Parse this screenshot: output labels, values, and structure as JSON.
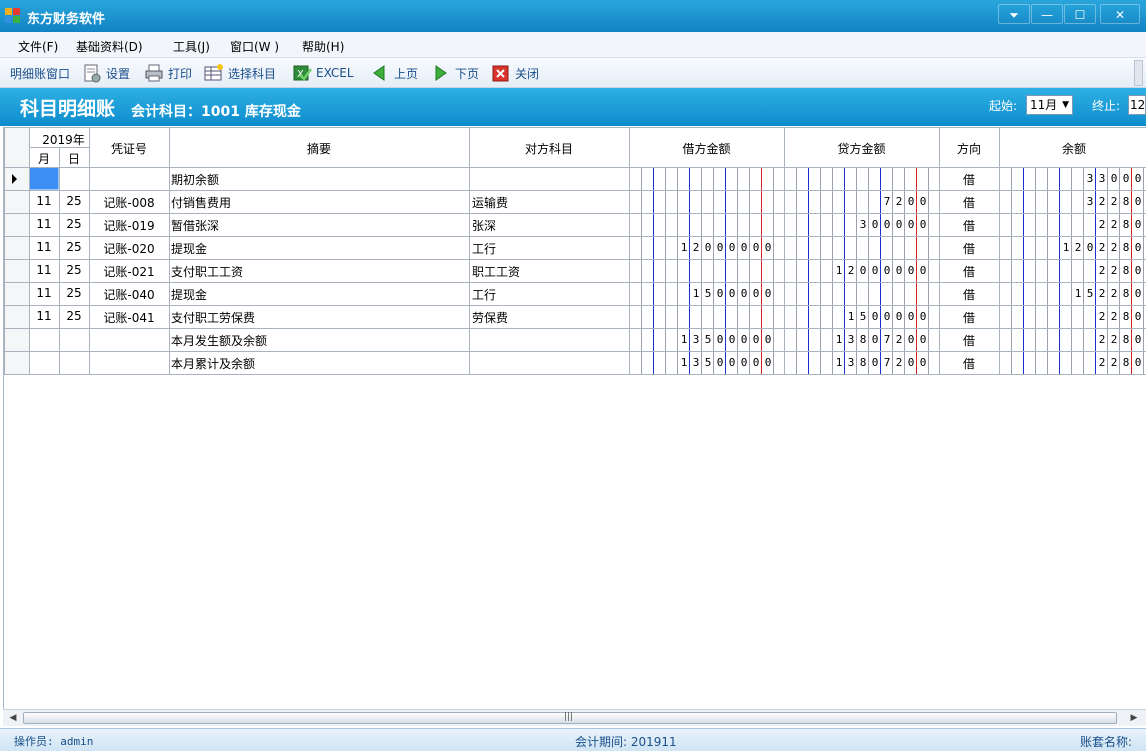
{
  "window": {
    "title": "东方财务软件",
    "buttons": {
      "dropdown": "⏷",
      "minimize": "—",
      "maximize": "☐",
      "close": "✕"
    }
  },
  "menu": [
    "文件(F)",
    "基础资料(D)",
    "工具(J)",
    "窗口(W )",
    "帮助(H)"
  ],
  "toolbar": {
    "window_label": "明细账窗口",
    "setup": "设置",
    "print": "打印",
    "select_subject": "选择科目",
    "excel": "EXCEL",
    "prev": "上页",
    "next": "下页",
    "close": "关闭"
  },
  "header": {
    "title": "科目明细账",
    "subject": "会计科目：1001 库存现金",
    "start_label": "起始:",
    "start_value": "11月",
    "end_label": "终止:",
    "end_value": "12"
  },
  "table": {
    "year": "2019年",
    "month": "月",
    "day": "日",
    "voucher": "凭证号",
    "summary": "摘要",
    "counter": "对方科目",
    "debit": "借方金额",
    "credit": "贷方金额",
    "direction": "方向",
    "balance": "余额",
    "rows": [
      {
        "month": "",
        "day": "",
        "voucher": "",
        "summary": "期初余额",
        "counter": "",
        "debit": "",
        "credit": "",
        "dir": "借",
        "balance": "33000"
      },
      {
        "month": "11",
        "day": "25",
        "voucher": "记账-008",
        "summary": "付销售费用",
        "counter": "运输费",
        "debit": "",
        "credit": "7200",
        "dir": "借",
        "balance": "32280"
      },
      {
        "month": "11",
        "day": "25",
        "voucher": "记账-019",
        "summary": "暂借张深",
        "counter": "张深",
        "debit": "",
        "credit": "300000",
        "dir": "借",
        "balance": "2280"
      },
      {
        "month": "11",
        "day": "25",
        "voucher": "记账-020",
        "summary": "提现金",
        "counter": "工行",
        "debit": "12000000",
        "credit": "",
        "dir": "借",
        "balance": "1202280"
      },
      {
        "month": "11",
        "day": "25",
        "voucher": "记账-021",
        "summary": "支付职工工资",
        "counter": "职工工资",
        "debit": "",
        "credit": "12000000",
        "dir": "借",
        "balance": "2280"
      },
      {
        "month": "11",
        "day": "25",
        "voucher": "记账-040",
        "summary": "提现金",
        "counter": "工行",
        "debit": "1500000",
        "credit": "",
        "dir": "借",
        "balance": "152280"
      },
      {
        "month": "11",
        "day": "25",
        "voucher": "记账-041",
        "summary": "支付职工劳保费",
        "counter": "劳保费",
        "debit": "",
        "credit": "1500000",
        "dir": "借",
        "balance": "2280"
      },
      {
        "month": "",
        "day": "",
        "voucher": "",
        "summary": "本月发生额及余额",
        "counter": "",
        "debit": "13500000",
        "credit": "13807200",
        "dir": "借",
        "balance": "2280"
      },
      {
        "month": "",
        "day": "",
        "voucher": "",
        "summary": "本月累计及余额",
        "counter": "",
        "debit": "13500000",
        "credit": "13807200",
        "dir": "借",
        "balance": "2280"
      }
    ]
  },
  "status": {
    "operator": "操作员: admin",
    "period": "会计期间: 201911",
    "account": "账套名称: 东"
  }
}
